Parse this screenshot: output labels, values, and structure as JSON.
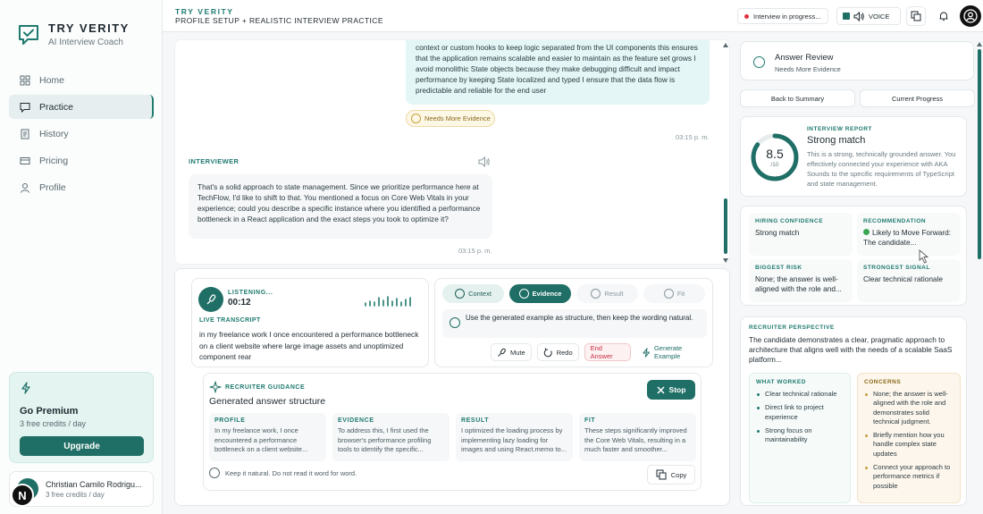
{
  "brand": {
    "title": "TRY VERITY",
    "subtitle": "AI Interview Coach"
  },
  "nav": [
    {
      "label": "Home",
      "icon": "grid-icon"
    },
    {
      "label": "Practice",
      "icon": "chat-icon",
      "active": true
    },
    {
      "label": "History",
      "icon": "document-icon"
    },
    {
      "label": "Pricing",
      "icon": "card-icon"
    },
    {
      "label": "Profile",
      "icon": "user-icon"
    }
  ],
  "premium": {
    "title": "Go Premium",
    "credits": "3 free credits / day",
    "button": "Upgrade"
  },
  "user": {
    "name": "Christian Camilo Rodrigu...",
    "credits": "3 free credits / day",
    "badge": "N"
  },
  "header": {
    "title": "TRY VERITY",
    "subtitle": "PROFILE SETUP + REALISTIC INTERVIEW PRACTICE",
    "status": "Interview in progress...",
    "voice": "VOICE"
  },
  "chat": {
    "user_message": "context or custom hooks to keep logic separated from the UI components this ensures that the application remains scalable and easier to maintain as the feature set grows I avoid monolithic State objects because they make debugging difficult and impact performance by keeping State localized and typed I ensure that the data flow is predictable and reliable for the end user",
    "evidence_badge": "Needs More Evidence",
    "user_time": "03:15 p. m.",
    "interviewer_label": "INTERVIEWER",
    "interviewer_message": "That's a solid approach to state management. Since we prioritize performance here at TechFlow, I'd like to shift to that. You mentioned a focus on Core Web Vitals in your experience; could you describe a specific instance where you identified a performance bottleneck in a React application and the exact steps you took to optimize it?",
    "interviewer_time": "03:15 p. m."
  },
  "listening": {
    "label": "LISTENING...",
    "time": "00:12",
    "transcript_label": "LIVE TRANSCRIPT",
    "transcript": "in my freelance work I once encountered a performance bottleneck on a client website where large image assets and unoptimized component rear"
  },
  "steps": [
    {
      "label": "Context",
      "state": "done"
    },
    {
      "label": "Evidence",
      "state": "active"
    },
    {
      "label": "Result",
      "state": "pending"
    },
    {
      "label": "Fit",
      "state": "pending"
    }
  ],
  "hint": "Use the generated example as structure, then keep the wording natural.",
  "actions": {
    "mute": "Mute",
    "redo": "Redo",
    "end": "End Answer",
    "generate": "Generate Example"
  },
  "guidance": {
    "label": "RECRUITER GUIDANCE",
    "title": "Generated answer structure",
    "stop": "Stop",
    "columns": [
      {
        "heading": "PROFILE",
        "text": "In my freelance work, I once encountered a performance bottleneck on a client website..."
      },
      {
        "heading": "EVIDENCE",
        "text": "To address this, I first used the browser's performance profiling tools to identify the specific..."
      },
      {
        "heading": "RESULT",
        "text": "I optimized the loading process by implementing lazy loading for images and using React.memo to..."
      },
      {
        "heading": "FIT",
        "text": "These steps significantly improved the Core Web Vitals, resulting in a much faster and smoother..."
      }
    ],
    "note": "Keep it natural. Do not read it word for word.",
    "copy": "Copy"
  },
  "review": {
    "title": "Answer Review",
    "subtitle": "Needs More Evidence",
    "back": "Back to Summary",
    "progress": "Current Progress",
    "report_label": "INTERVIEW REPORT",
    "score": "8.5",
    "score_den": "/10",
    "score_fraction": 0.85,
    "report_title": "Strong match",
    "report_text": "This is a strong, technically grounded answer. You effectively connected your experience with AKA Sounds to the specific requirements of TypeScript and state management.",
    "tiles": [
      {
        "heading": "HIRING CONFIDENCE",
        "text": "Strong match"
      },
      {
        "heading": "RECOMMENDATION",
        "text": "Likely to Move Forward: The candidate..."
      },
      {
        "heading": "BIGGEST RISK",
        "text": "None; the answer is well-aligned with the role and..."
      },
      {
        "heading": "STRONGEST SIGNAL",
        "text": "Clear technical rationale"
      }
    ],
    "perspective_label": "RECRUITER PERSPECTIVE",
    "perspective_text": "The candidate demonstrates a clear, pragmatic approach to architecture that aligns well with the needs of a scalable SaaS platform...",
    "worked_label": "WHAT WORKED",
    "worked": [
      "Clear technical rationale",
      "Direct link to project experience",
      "Strong focus on maintainability"
    ],
    "concerns_label": "CONCERNS",
    "concerns": [
      "None; the answer is well-aligned with the role and demonstrates solid technical judgment.",
      "Briefly mention how you handle complex state updates",
      "Connect your approach to performance metrics if possible"
    ]
  },
  "colors": {
    "accent": "#1f6f66",
    "danger": "#c43040",
    "warn": "#c6a13e"
  }
}
